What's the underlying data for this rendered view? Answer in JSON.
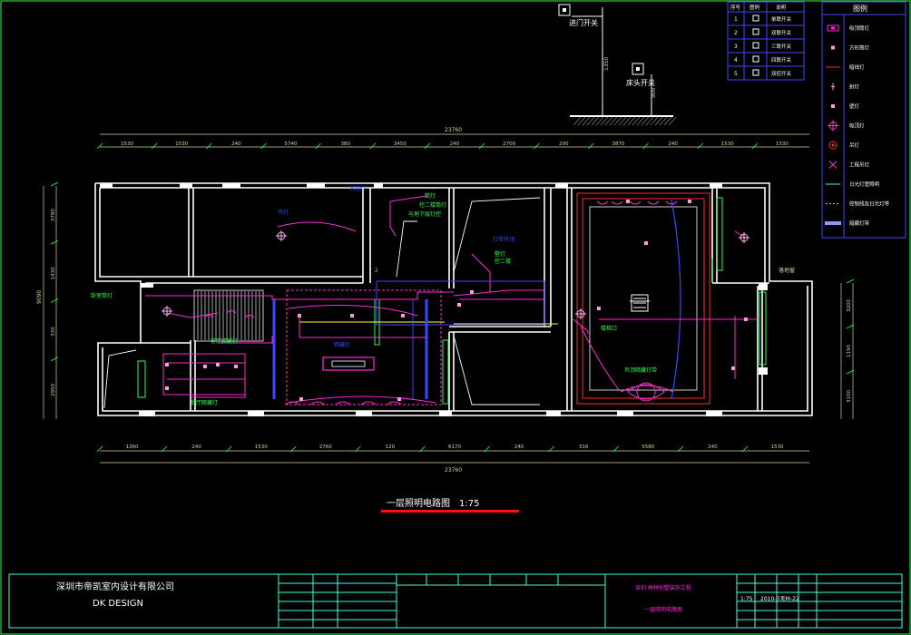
{
  "drawing": {
    "title": "一层照明电路图",
    "scale": "1:75"
  },
  "switch_labels": {
    "entry_switch": "进门开关",
    "bedside_switch": "床头开关"
  },
  "elevation_labels": {
    "entry_height": "1350",
    "bedside_height": "900"
  },
  "dimensions": {
    "overall_top": "23760",
    "overall_bottom": "23760",
    "top_segments": [
      "1530",
      "1530",
      "240",
      "5740",
      "380",
      "3450",
      "240",
      "2700",
      "200",
      "3870",
      "240",
      "1530",
      "1530"
    ],
    "bottom_segments": [
      "1360",
      "240",
      "1530",
      "2760",
      "120",
      "6170",
      "240",
      "316",
      "5580",
      "240",
      "1530"
    ],
    "left_total": "9090",
    "left_segments": [
      "3780",
      "1430",
      "330",
      "2950"
    ],
    "right_segments": [
      "3200",
      "1190",
      "3100"
    ]
  },
  "room_notes": [
    {
      "id": "n1",
      "text": "吊灯"
    },
    {
      "id": "n2",
      "text": "筒灯"
    },
    {
      "id": "n3",
      "text": "控二楼筒灯"
    },
    {
      "id": "n4",
      "text": "与地下层灯控"
    },
    {
      "id": "n5",
      "text": "卧室筒灯"
    },
    {
      "id": "n6",
      "text": "客厅暗藏灯"
    },
    {
      "id": "n7",
      "text": "暗藏灯"
    },
    {
      "id": "n8",
      "text": "壁灯"
    },
    {
      "id": "n9",
      "text": "灯带吊顶"
    },
    {
      "id": "n10",
      "text": "吊顶暗藏灯带"
    },
    {
      "id": "n11",
      "text": "餐厅暗藏灯"
    },
    {
      "id": "n12",
      "text": "控二楼"
    },
    {
      "id": "n13",
      "text": "楼梯口"
    },
    {
      "id": "n14",
      "text": "吊顶灯"
    },
    {
      "id": "n15",
      "text": "2"
    },
    {
      "id": "n16",
      "text": "落地窗"
    }
  ],
  "switch_table": {
    "headers": [
      "序号",
      "图例",
      "说明"
    ],
    "rows": [
      {
        "num": "1",
        "desc": "单联开关"
      },
      {
        "num": "2",
        "desc": "双联开关"
      },
      {
        "num": "3",
        "desc": "三联开关"
      },
      {
        "num": "4",
        "desc": "四联开关"
      },
      {
        "num": "5",
        "desc": "双控开关"
      }
    ]
  },
  "legend": {
    "title": "图例",
    "items": [
      {
        "symbol": "spot-box",
        "label": "吸顶筒灯"
      },
      {
        "symbol": "square-small",
        "label": "方形筒灯"
      },
      {
        "symbol": "red-line",
        "label": "暗线灯"
      },
      {
        "symbol": "plus-mark",
        "label": "射灯"
      },
      {
        "symbol": "square-small",
        "label": "壁灯"
      },
      {
        "symbol": "chandelier",
        "label": "吸顶灯"
      },
      {
        "symbol": "ring",
        "label": "吊灯"
      },
      {
        "symbol": "cross",
        "label": "工程吊灯"
      },
      {
        "symbol": "bar-label",
        "label": "日光灯管照明"
      },
      {
        "symbol": "dashed",
        "label": "控制线及日光灯带"
      },
      {
        "symbol": "blue-bar",
        "label": "暗藏灯带"
      }
    ]
  },
  "title_block": {
    "company_cn": "深圳市帝凯室内设计有限公司",
    "company_en": "DK   DESIGN",
    "project": "深圳 梅林别墅装饰工程",
    "sheet_name": "一层照明电路图",
    "date": "2010-07",
    "scale": "1:75",
    "sheet_no": "EM-22"
  },
  "colors": {
    "wall": "#ffffff",
    "dimension": "#d8d2a8",
    "circuit": "#ff2bd6",
    "fixture_green": "#2cff4f",
    "ceiling_red": "#ff2a2a",
    "strip_blue": "#3b47ff",
    "frame_cyan": "#40ffe0",
    "underline": "#ff1010"
  }
}
